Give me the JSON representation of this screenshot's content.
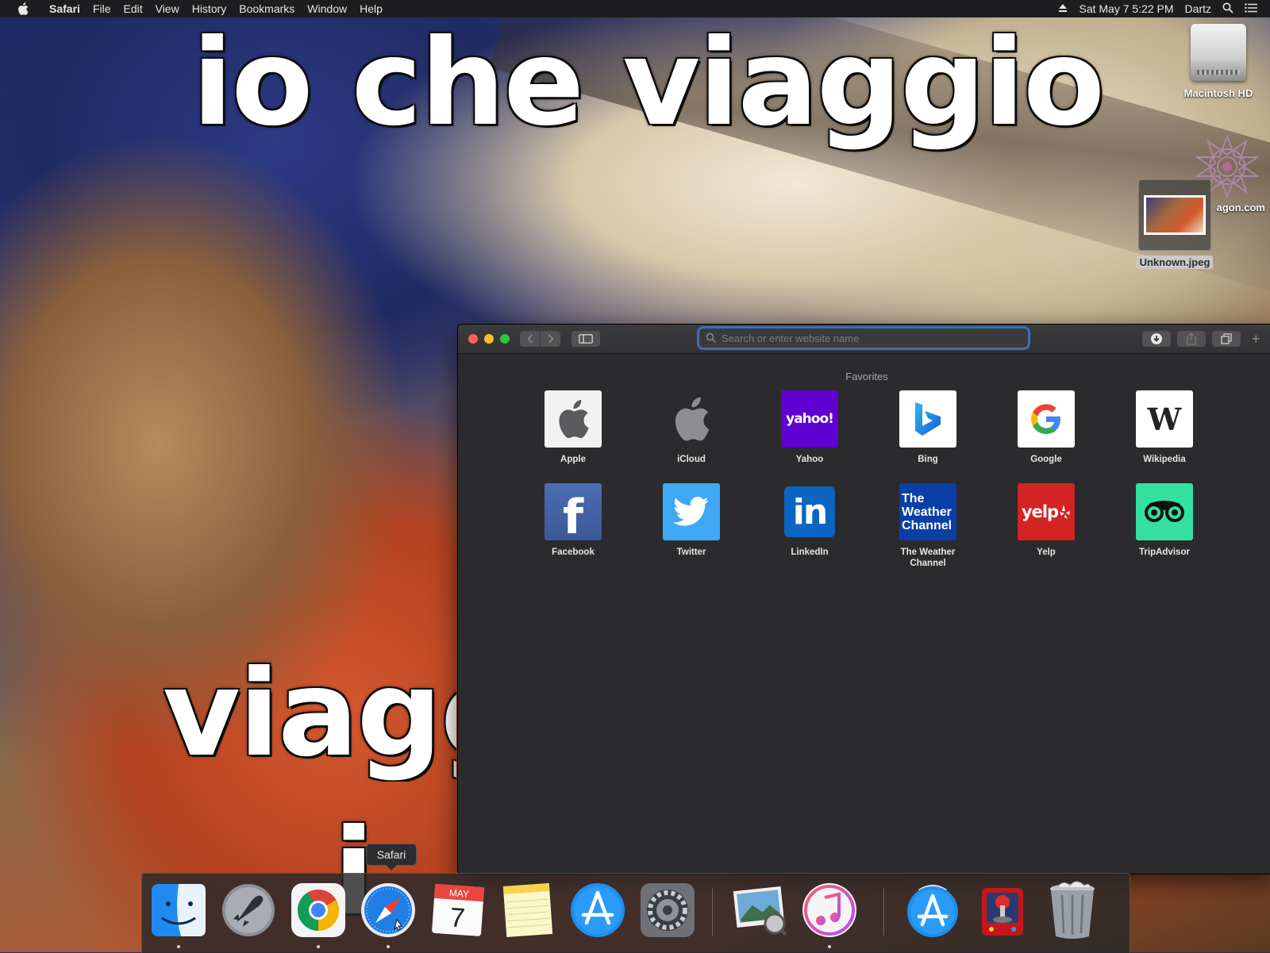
{
  "menubar": {
    "app_name": "Safari",
    "items": [
      "File",
      "Edit",
      "View",
      "History",
      "Bookmarks",
      "Window",
      "Help"
    ],
    "datetime": "Sat May 7  5:22 PM",
    "user": "Dartz"
  },
  "wallpaper": {
    "top_text": "io che viaggio",
    "bottom_text": "viagg",
    "bottom_text_2": "i"
  },
  "desktop": {
    "hd_label": "Macintosh HD",
    "wagon_label": "agon.com",
    "jpeg_label": "Unknown.jpeg"
  },
  "safari": {
    "search_placeholder": "Search or enter website name",
    "new_tab": "+",
    "favorites_title": "Favorites",
    "favorites": [
      {
        "name": "Apple"
      },
      {
        "name": "iCloud"
      },
      {
        "name": "Yahoo",
        "logo_text": "yahoo!",
        "color": "#5f01d1"
      },
      {
        "name": "Bing"
      },
      {
        "name": "Google"
      },
      {
        "name": "Wikipedia",
        "logo_text": "W"
      },
      {
        "name": "Facebook",
        "logo_text": "f",
        "color": "#3b5998"
      },
      {
        "name": "Twitter",
        "color": "#1da1f2"
      },
      {
        "name": "LinkedIn",
        "logo_text": "in",
        "color": "#0a66c2"
      },
      {
        "name": "The Weather Channel",
        "logo_text": "The Weather Channel",
        "color": "#0a3fa6"
      },
      {
        "name": "Yelp",
        "logo_text": "yelp",
        "color": "#d32323"
      },
      {
        "name": "TripAdvisor",
        "color": "#34e0a1"
      }
    ]
  },
  "dock": {
    "tooltip": "Safari",
    "calendar_month": "MAY",
    "calendar_day": "7"
  },
  "colors": {
    "accent_focus": "#3d6fb5",
    "close": "#fe5f57",
    "minimize": "#febc2e",
    "maximize": "#28c840"
  }
}
